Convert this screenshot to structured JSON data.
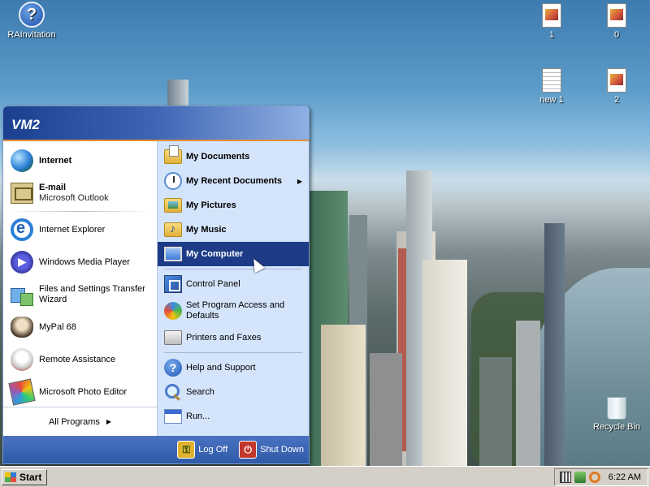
{
  "desktop": {
    "icons": [
      {
        "label": "RAInvitation",
        "icon": "help-file-icon"
      },
      {
        "label": "1",
        "icon": "image-file-icon"
      },
      {
        "label": "0",
        "icon": "image-file-icon"
      },
      {
        "label": "new 1",
        "icon": "text-file-icon"
      },
      {
        "label": "2",
        "icon": "image-file-icon"
      },
      {
        "label": "Recycle Bin",
        "icon": "recycle-bin-icon"
      }
    ]
  },
  "start_menu": {
    "user": "VM2",
    "left": {
      "pinned": [
        {
          "title": "Internet",
          "subtitle": "",
          "icon": "globe-icon"
        },
        {
          "title": "E-mail",
          "subtitle": "Microsoft Outlook",
          "icon": "mail-icon"
        }
      ],
      "recent": [
        {
          "label": "Internet Explorer",
          "icon": "internet-explorer-icon"
        },
        {
          "label": "Windows Media Player",
          "icon": "media-player-icon"
        },
        {
          "label": "Files and Settings Transfer Wizard",
          "icon": "transfer-wizard-icon"
        },
        {
          "label": "MyPal 68",
          "icon": "mypal-icon"
        },
        {
          "label": "Remote Assistance",
          "icon": "remote-assistance-icon"
        },
        {
          "label": "Microsoft Photo Editor",
          "icon": "photo-editor-icon"
        }
      ],
      "all_programs": "All Programs"
    },
    "right": {
      "group1": [
        {
          "label": "My Documents",
          "icon": "my-documents-icon",
          "submenu": false
        },
        {
          "label": "My Recent Documents",
          "icon": "recent-documents-icon",
          "submenu": true
        },
        {
          "label": "My Pictures",
          "icon": "my-pictures-icon",
          "submenu": false
        },
        {
          "label": "My Music",
          "icon": "my-music-icon",
          "submenu": false
        },
        {
          "label": "My Computer",
          "icon": "my-computer-icon",
          "submenu": false,
          "highlighted": true
        }
      ],
      "group2": [
        {
          "label": "Control Panel",
          "icon": "control-panel-icon"
        },
        {
          "label": "Set Program Access and Defaults",
          "icon": "program-access-icon"
        },
        {
          "label": "Printers and Faxes",
          "icon": "printer-icon"
        }
      ],
      "group3": [
        {
          "label": "Help and Support",
          "icon": "help-icon"
        },
        {
          "label": "Search",
          "icon": "search-icon"
        },
        {
          "label": "Run...",
          "icon": "run-icon"
        }
      ]
    },
    "footer": {
      "log_off": "Log Off",
      "shut_down": "Shut Down"
    }
  },
  "taskbar": {
    "start_label": "Start",
    "time": "6:22 AM"
  },
  "colors": {
    "highlight": "#1d3b86",
    "header_left": "#1a3f8f",
    "header_right": "#8fb0e3",
    "right_pane": "#d3e4fb",
    "taskbar": "#d4d0c8"
  }
}
